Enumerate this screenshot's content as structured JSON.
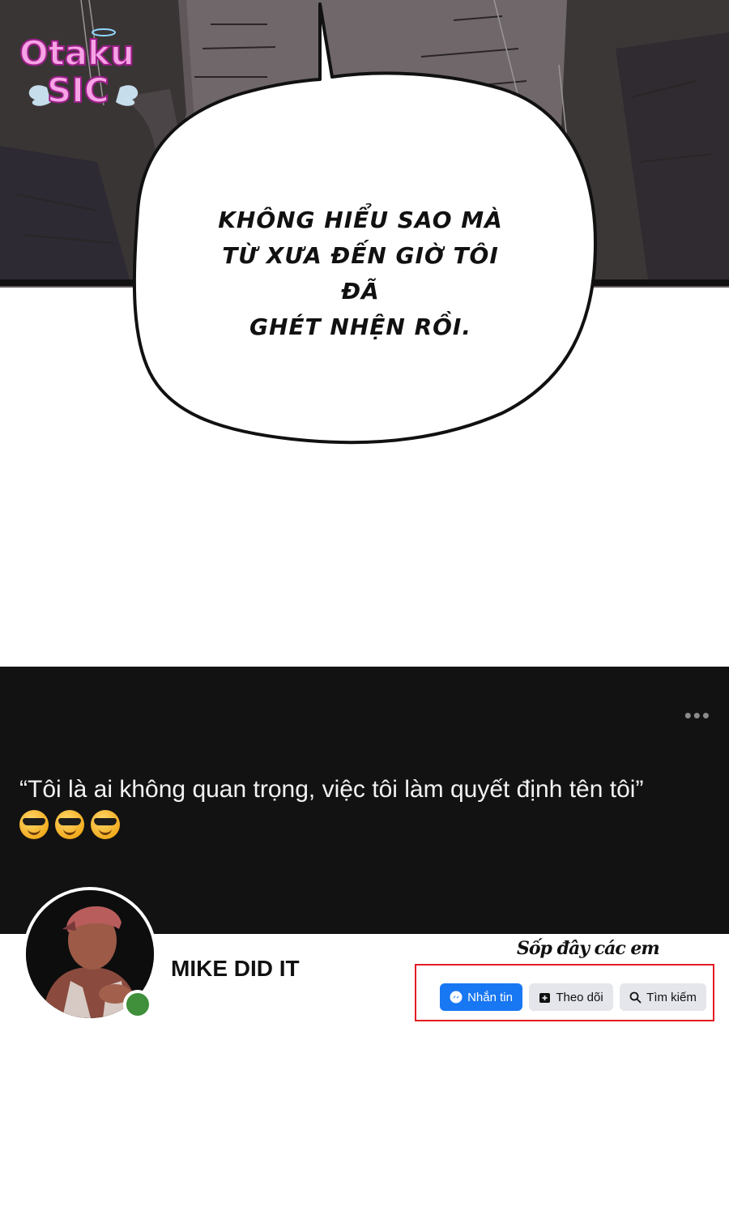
{
  "watermark": {
    "line1": "Otaku",
    "line2": "SIC"
  },
  "comic": {
    "bubble_lines": [
      "KHÔNG HIỂU SAO MÀ",
      "TỪ XƯA ĐẾN GIỜ TÔI ĐÃ",
      "GHÉT NHỆN RỒI."
    ]
  },
  "profile": {
    "quote": "“Tôi là ai không quan trọng, việc tôi làm quyết định tên tôi”",
    "emojis": [
      "sunglasses-face",
      "sunglasses-face",
      "sunglasses-face"
    ],
    "name": "MIKE DID IT",
    "more_label": "•••",
    "annotation": "Sốp đây các em",
    "buttons": {
      "message": {
        "label": "Nhắn tin",
        "icon": "messenger-icon"
      },
      "follow": {
        "label": "Theo dõi",
        "icon": "follow-icon"
      },
      "search": {
        "label": "Tìm kiếm",
        "icon": "search-icon"
      }
    },
    "colors": {
      "accent": "#1877f2",
      "online": "#3f8f3b",
      "highlight": "#e11d25",
      "cover": "#121213"
    }
  }
}
